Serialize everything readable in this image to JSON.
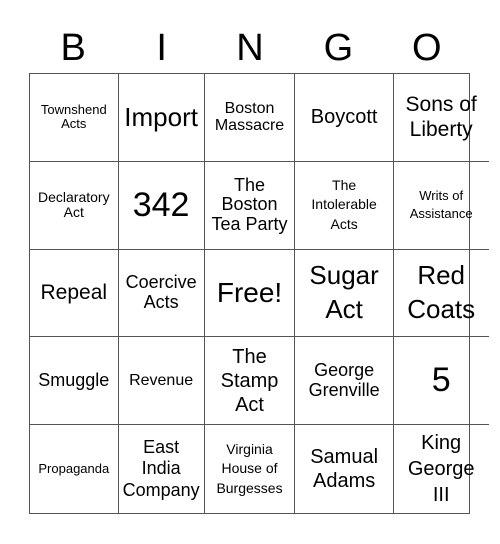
{
  "header": [
    "B",
    "I",
    "N",
    "G",
    "O"
  ],
  "cells": [
    "Townshend Acts",
    "Import",
    "Boston Massacre",
    "Boycott",
    "Sons of Liberty",
    "Declaratory Act",
    "342",
    "The Boston Tea Party",
    "The Intolerable Acts",
    "Writs of Assistance",
    "Repeal",
    "Coercive Acts",
    "Free!",
    "Sugar Act",
    "Red Coats",
    "Smuggle",
    "Revenue",
    "The Stamp Act",
    "George Grenville",
    "5",
    "Propaganda",
    "East India Company",
    "Virginia House of Burgesses",
    "Samual Adams",
    "King George III"
  ]
}
